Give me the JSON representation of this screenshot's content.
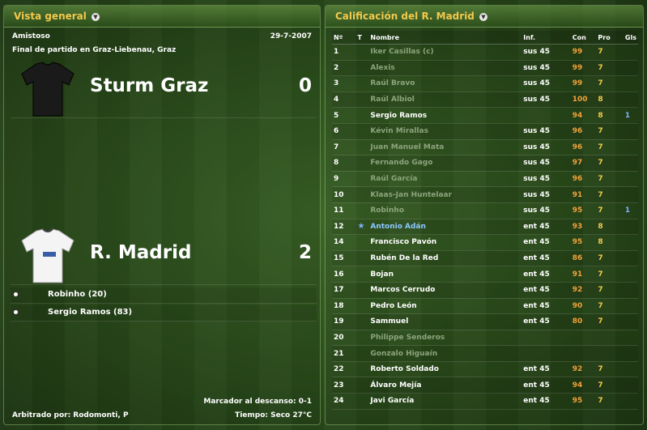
{
  "left_panel": {
    "title": "Vista general",
    "match_type": "Amistoso",
    "date": "29-7-2007",
    "venue": "Final de partido en Graz-Liebenau, Graz",
    "home": {
      "name": "Sturm Graz",
      "score": "0",
      "shirt_color": "#1a1a1a"
    },
    "away": {
      "name": "R. Madrid",
      "score": "2",
      "shirt_color": "#f4f4f4"
    },
    "goals": [
      "Robinho (20)",
      "Sergio Ramos (83)"
    ],
    "halftime": "Marcador al descanso: 0-1",
    "referee": "Arbitrado por: Rodomonti, P",
    "weather": "Tiempo: Seco 27°C"
  },
  "right_panel": {
    "title": "Calificación del R. Madrid",
    "headers": {
      "num": "Nº",
      "t": "T",
      "name": "Nombre",
      "inf": "Inf.",
      "con": "Con",
      "pro": "Pro",
      "gls": "Gls"
    },
    "players": [
      {
        "num": "1",
        "name": "Iker Casillas (c)",
        "inf": "sus 45",
        "con": "99",
        "pro": "7",
        "gls": "",
        "style": "dim"
      },
      {
        "num": "2",
        "name": "Alexis",
        "inf": "sus 45",
        "con": "99",
        "pro": "7",
        "gls": "",
        "style": "dim"
      },
      {
        "num": "3",
        "name": "Raúl Bravo",
        "inf": "sus 45",
        "con": "99",
        "pro": "7",
        "gls": "",
        "style": "dim"
      },
      {
        "num": "4",
        "name": "Raúl Albiol",
        "inf": "sus 45",
        "con": "100",
        "pro": "8",
        "gls": "",
        "style": "dim"
      },
      {
        "num": "5",
        "name": "Sergio Ramos",
        "inf": "",
        "con": "94",
        "pro": "8",
        "gls": "1",
        "style": "normal"
      },
      {
        "num": "6",
        "name": "Kévin Mirallas",
        "inf": "sus 45",
        "con": "96",
        "pro": "7",
        "gls": "",
        "style": "dim"
      },
      {
        "num": "7",
        "name": "Juan Manuel Mata",
        "inf": "sus 45",
        "con": "96",
        "pro": "7",
        "gls": "",
        "style": "dim"
      },
      {
        "num": "8",
        "name": "Fernando Gago",
        "inf": "sus 45",
        "con": "97",
        "pro": "7",
        "gls": "",
        "style": "dim"
      },
      {
        "num": "9",
        "name": "Raúl García",
        "inf": "sus 45",
        "con": "96",
        "pro": "7",
        "gls": "",
        "style": "dim"
      },
      {
        "num": "10",
        "name": "Klaas-Jan Huntelaar",
        "inf": "sus 45",
        "con": "91",
        "pro": "7",
        "gls": "",
        "style": "dim"
      },
      {
        "num": "11",
        "name": "Robinho",
        "inf": "sus 45",
        "con": "95",
        "pro": "7",
        "gls": "1",
        "style": "dim"
      },
      {
        "num": "12",
        "name": "Antonio Adán",
        "inf": "ent 45",
        "con": "93",
        "pro": "8",
        "gls": "",
        "style": "hl",
        "star": "★"
      },
      {
        "num": "14",
        "name": "Francisco Pavón",
        "inf": "ent 45",
        "con": "95",
        "pro": "8",
        "gls": "",
        "style": "normal"
      },
      {
        "num": "15",
        "name": "Rubén De la Red",
        "inf": "ent 45",
        "con": "86",
        "pro": "7",
        "gls": "",
        "style": "normal"
      },
      {
        "num": "16",
        "name": "Bojan",
        "inf": "ent 45",
        "con": "91",
        "pro": "7",
        "gls": "",
        "style": "normal"
      },
      {
        "num": "17",
        "name": "Marcos Cerrudo",
        "inf": "ent 45",
        "con": "92",
        "pro": "7",
        "gls": "",
        "style": "normal"
      },
      {
        "num": "18",
        "name": "Pedro León",
        "inf": "ent 45",
        "con": "90",
        "pro": "7",
        "gls": "",
        "style": "normal"
      },
      {
        "num": "19",
        "name": "Sammuel",
        "inf": "ent 45",
        "con": "80",
        "pro": "7",
        "gls": "",
        "style": "normal"
      },
      {
        "num": "20",
        "name": "Philippe Senderos",
        "inf": "",
        "con": "",
        "pro": "",
        "gls": "",
        "style": "dim"
      },
      {
        "num": "21",
        "name": "Gonzalo Higuaín",
        "inf": "",
        "con": "",
        "pro": "",
        "gls": "",
        "style": "dim"
      },
      {
        "num": "22",
        "name": "Roberto Soldado",
        "inf": "ent 45",
        "con": "92",
        "pro": "7",
        "gls": "",
        "style": "normal"
      },
      {
        "num": "23",
        "name": "Álvaro Mejía",
        "inf": "ent 45",
        "con": "94",
        "pro": "7",
        "gls": "",
        "style": "normal"
      },
      {
        "num": "24",
        "name": "Javi García",
        "inf": "ent 45",
        "con": "95",
        "pro": "7",
        "gls": "",
        "style": "normal"
      }
    ]
  }
}
